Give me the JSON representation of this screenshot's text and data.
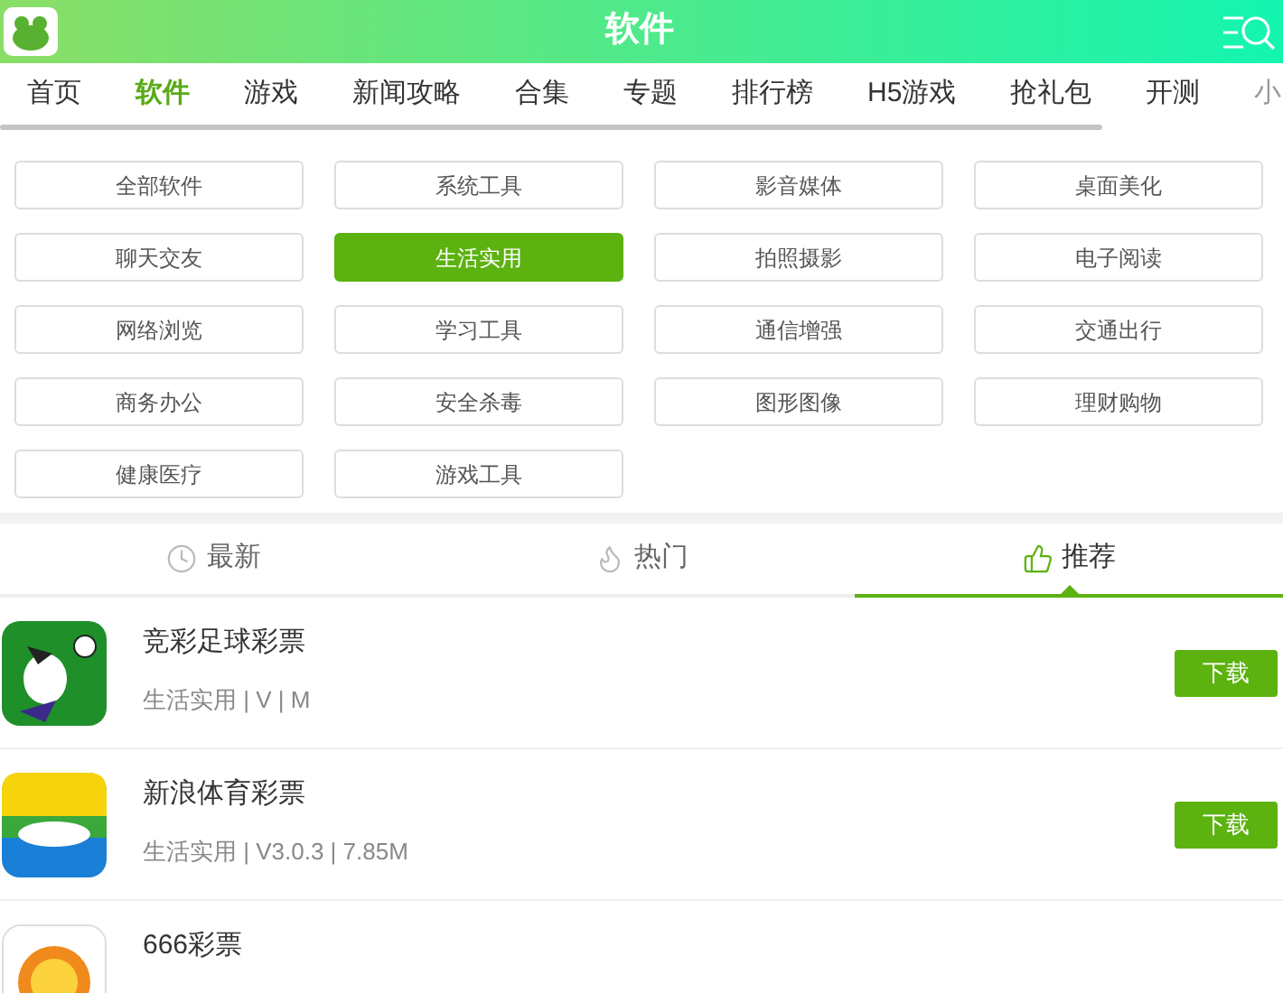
{
  "header": {
    "title": "软件"
  },
  "nav": [
    {
      "label": "首页",
      "selected": false
    },
    {
      "label": "软件",
      "selected": true
    },
    {
      "label": "游戏",
      "selected": false
    },
    {
      "label": "新闻攻略",
      "selected": false
    },
    {
      "label": "合集",
      "selected": false
    },
    {
      "label": "专题",
      "selected": false
    },
    {
      "label": "排行榜",
      "selected": false
    },
    {
      "label": "H5游戏",
      "selected": false
    },
    {
      "label": "抢礼包",
      "selected": false
    },
    {
      "label": "开测",
      "selected": false
    },
    {
      "label": "小",
      "selected": false
    }
  ],
  "categories": [
    {
      "label": "全部软件",
      "selected": false
    },
    {
      "label": "系统工具",
      "selected": false
    },
    {
      "label": "影音媒体",
      "selected": false
    },
    {
      "label": "桌面美化",
      "selected": false
    },
    {
      "label": "聊天交友",
      "selected": false
    },
    {
      "label": "生活实用",
      "selected": true
    },
    {
      "label": "拍照摄影",
      "selected": false
    },
    {
      "label": "电子阅读",
      "selected": false
    },
    {
      "label": "网络浏览",
      "selected": false
    },
    {
      "label": "学习工具",
      "selected": false
    },
    {
      "label": "通信增强",
      "selected": false
    },
    {
      "label": "交通出行",
      "selected": false
    },
    {
      "label": "商务办公",
      "selected": false
    },
    {
      "label": "安全杀毒",
      "selected": false
    },
    {
      "label": "图形图像",
      "selected": false
    },
    {
      "label": "理财购物",
      "selected": false
    },
    {
      "label": "健康医疗",
      "selected": false
    },
    {
      "label": "游戏工具",
      "selected": false
    }
  ],
  "tabs": [
    {
      "label": "最新",
      "selected": false
    },
    {
      "label": "热门",
      "selected": false
    },
    {
      "label": "推荐",
      "selected": true
    }
  ],
  "apps": [
    {
      "name": "竞彩足球彩票",
      "meta": "生活实用 | V | M",
      "button": "下载"
    },
    {
      "name": "新浪体育彩票",
      "meta": "生活实用 | V3.0.3 | 7.85M",
      "button": "下载"
    },
    {
      "name": "666彩票"
    }
  ]
}
